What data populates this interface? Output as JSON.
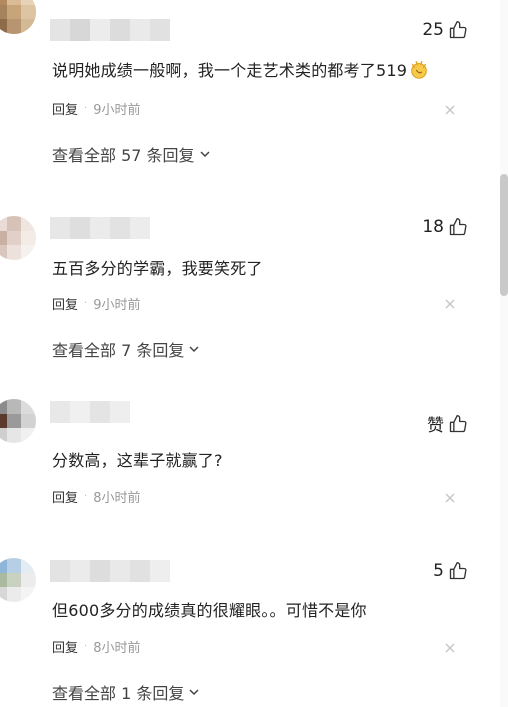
{
  "comments": [
    {
      "likes": "25",
      "text": "说明她成绩一般啊，我一个走艺术类的都考了519",
      "reply_label": "回复",
      "dot": "·",
      "time": "9小时前",
      "view_all": "查看全部 57 条回复"
    },
    {
      "likes": "18",
      "text": "五百多分的学霸，我要笑死了",
      "reply_label": "回复",
      "dot": "·",
      "time": "9小时前",
      "view_all": "查看全部 7 条回复"
    },
    {
      "likes": "赞",
      "text": "分数高，这辈子就赢了?",
      "reply_label": "回复",
      "dot": "·",
      "time": "8小时前"
    },
    {
      "likes": "5",
      "text": "但600多分的成绩真的很耀眼。。可惜不是你",
      "reply_label": "回复",
      "dot": "·",
      "time": "8小时前",
      "view_all": "查看全部 1 条回复"
    }
  ],
  "icons": {
    "like": "thumbs-up-icon",
    "close": "close-icon",
    "chevron": "chevron-down-icon",
    "emoji": "clapping-hands-emoji"
  }
}
